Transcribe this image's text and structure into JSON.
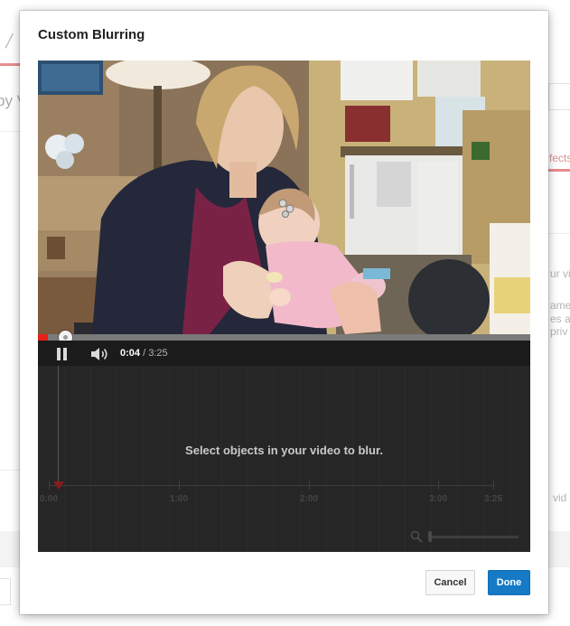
{
  "background": {
    "title_fragment": "py V",
    "tab_fragment": "fects",
    "text_fragment_1": "ur vi",
    "text_fragment_2": "ame",
    "text_fragment_3": "es a",
    "text_fragment_4": "priv",
    "text_fragment_5": "vid"
  },
  "dialog": {
    "title": "Custom Blurring"
  },
  "player": {
    "progress_fraction": 0.02,
    "current_time": "0:04",
    "separator": " / ",
    "duration": "3:25",
    "icons": {
      "play_pause": "pause-icon",
      "volume": "volume-icon"
    }
  },
  "editor": {
    "message": "Select objects in your video to blur.",
    "timeline_labels": [
      "0:00",
      "1:00",
      "2:00",
      "3:00",
      "3:25"
    ],
    "zoom_icon": "magnifier-icon"
  },
  "buttons": {
    "cancel": "Cancel",
    "done": "Done"
  },
  "colors": {
    "progress": "#e62117",
    "primary": "#167ac6"
  }
}
